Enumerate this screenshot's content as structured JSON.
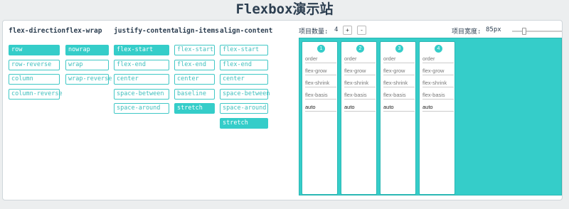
{
  "page_title": "Flexbox演示站",
  "columns": [
    {
      "name": "flex-direction",
      "options": [
        "row",
        "row-reverse",
        "column",
        "column-reverse"
      ],
      "selected": 0
    },
    {
      "name": "flex-wrap",
      "options": [
        "nowrap",
        "wrap",
        "wrap-reverse"
      ],
      "selected": 0
    },
    {
      "name": "justify-content",
      "options": [
        "flex-start",
        "flex-end",
        "center",
        "space-between",
        "space-around"
      ],
      "selected": 0
    },
    {
      "name": "align-items",
      "options": [
        "flex-start",
        "flex-end",
        "center",
        "baseline",
        "stretch"
      ],
      "selected": 4
    },
    {
      "name": "align-content",
      "options": [
        "flex-start",
        "flex-end",
        "center",
        "space-between",
        "space-around",
        "stretch"
      ],
      "selected": 5
    }
  ],
  "controls": {
    "count_label": "项目数量:",
    "count_value": "4",
    "increment_label": "+",
    "decrement_label": "-",
    "width_label": "项目宽度:",
    "width_value": "85px",
    "width_slider_fraction": 0.22
  },
  "items": [
    {
      "number": "1",
      "order": "order",
      "flex_grow": "flex-grow",
      "flex_shrink": "flex-shrink",
      "flex_basis": "flex-basis",
      "basis_value": "auto"
    },
    {
      "number": "2",
      "order": "order",
      "flex_grow": "flex-grow",
      "flex_shrink": "flex-shrink",
      "flex_basis": "flex-basis",
      "basis_value": "auto"
    },
    {
      "number": "3",
      "order": "order",
      "flex_grow": "flex-grow",
      "flex_shrink": "flex-shrink",
      "flex_basis": "flex-basis",
      "basis_value": "auto"
    },
    {
      "number": "4",
      "order": "order",
      "flex_grow": "flex-grow",
      "flex_shrink": "flex-shrink",
      "flex_basis": "flex-basis",
      "basis_value": "auto"
    }
  ],
  "colors": {
    "accent": "#35cdc9",
    "text": "#2c3e50"
  }
}
